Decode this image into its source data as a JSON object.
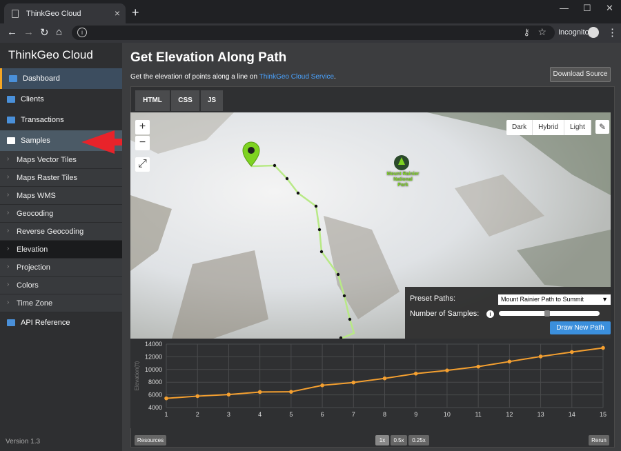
{
  "browser": {
    "tab_title": "ThinkGeo Cloud",
    "incognito_label": "Incognito"
  },
  "sidebar": {
    "brand": "ThinkGeo Cloud",
    "items": [
      {
        "label": "Dashboard",
        "icon": "dashboard-icon"
      },
      {
        "label": "Clients",
        "icon": "credit-card-icon"
      },
      {
        "label": "Transactions",
        "icon": "bar-chart-icon"
      },
      {
        "label": "Samples",
        "icon": "puzzle-icon"
      }
    ],
    "sub_items": [
      {
        "label": "Maps Vector Tiles"
      },
      {
        "label": "Maps Raster Tiles"
      },
      {
        "label": "Maps WMS"
      },
      {
        "label": "Geocoding"
      },
      {
        "label": "Reverse Geocoding"
      },
      {
        "label": "Elevation"
      },
      {
        "label": "Projection"
      },
      {
        "label": "Colors"
      },
      {
        "label": "Time Zone"
      }
    ],
    "api_reference": "API Reference",
    "version": "Version 1.3"
  },
  "main": {
    "title": "Get Elevation Along Path",
    "desc_prefix": "Get the elevation of points along a line on ",
    "desc_link": "ThinkGeo Cloud Service",
    "desc_suffix": ".",
    "download_source": "Download Source",
    "code_tabs": [
      "HTML",
      "CSS",
      "JS"
    ]
  },
  "map": {
    "zoom_in": "+",
    "zoom_out": "−",
    "fullscreen": "⤢",
    "layers": [
      "Dark",
      "Hybrid",
      "Light"
    ],
    "park_label_1": "Mount Rainier",
    "park_label_2": "National",
    "park_label_3": "Park"
  },
  "controls": {
    "preset_label": "Preset Paths:",
    "preset_value": "Mount Rainier Path to Summit",
    "samples_label": "Number of Samples:",
    "samples_fraction": 0.48,
    "draw_button": "Draw New Path"
  },
  "chart_data": {
    "type": "line",
    "ylabel": "Elevation(ft)",
    "x": [
      1,
      2,
      3,
      4,
      5,
      6,
      7,
      8,
      9,
      10,
      11,
      12,
      13,
      14,
      15
    ],
    "y": [
      5450,
      5800,
      6050,
      6450,
      6480,
      7500,
      7950,
      8600,
      9350,
      9850,
      10450,
      11250,
      12050,
      12750,
      13400
    ],
    "ylim": [
      4000,
      14000
    ],
    "yticks": [
      4000,
      6000,
      8000,
      10000,
      12000,
      14000
    ],
    "xticks": [
      1,
      2,
      3,
      4,
      5,
      6,
      7,
      8,
      9,
      10,
      11,
      12,
      13,
      14,
      15
    ],
    "line_color": "#f5a030",
    "grid": true
  },
  "footer": {
    "resources": "Resources",
    "speeds": [
      "1x",
      "0.5x",
      "0.25x"
    ],
    "rerun": "Rerun"
  }
}
